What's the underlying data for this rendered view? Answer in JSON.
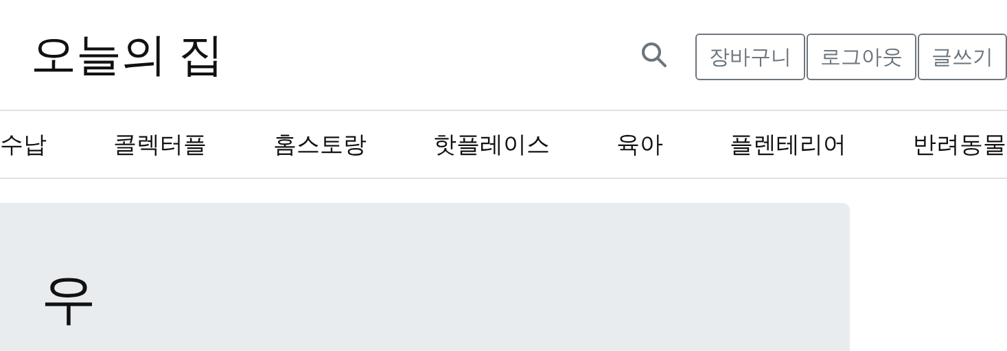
{
  "header": {
    "logo": "오늘의 집",
    "buttons": [
      "장바구니",
      "로그아웃",
      "글쓰기"
    ]
  },
  "nav": {
    "items": [
      "수납",
      "콜렉터플",
      "홈스토랑",
      "핫플레이스",
      "육아",
      "플렌테리어",
      "반려동물"
    ]
  },
  "hero": {
    "heading": "우"
  }
}
